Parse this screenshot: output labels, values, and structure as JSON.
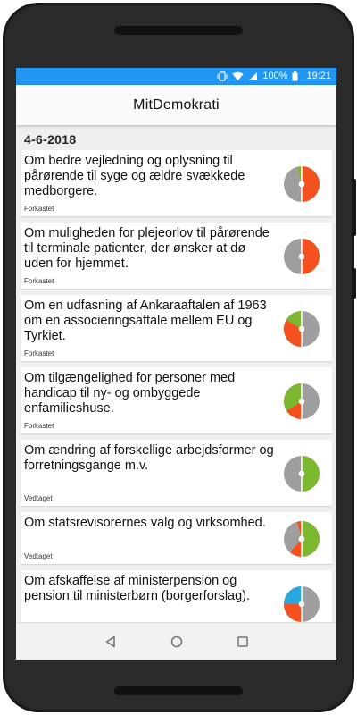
{
  "status_bar": {
    "battery": "100%",
    "time": "19:21"
  },
  "app": {
    "title": "MitDemokrati"
  },
  "section": {
    "date": "4-6-2018"
  },
  "proposals": [
    {
      "title": "Om bedre vejledning og oplysning til pårørende til syge og ældre svækkede medborgere.",
      "status": "Forkastet",
      "vote_icon": "vote-pie-chart",
      "colors": {
        "for": "#7cb82f",
        "against": "#f4511e",
        "absent": "#9e9e9e"
      }
    },
    {
      "title": "Om muligheden for plejeorlov til pårørende til terminale patienter, der ønsker at dø uden for hjemmet.",
      "status": "Forkastet",
      "vote_icon": "vote-pie-chart",
      "colors": {
        "for": "#7cb82f",
        "against": "#f4511e",
        "absent": "#9e9e9e"
      }
    },
    {
      "title": "Om en udfasning af Ankaraaftalen af 1963 om en associeringsaftale mellem EU og Tyrkiet.",
      "status": "Forkastet",
      "vote_icon": "vote-pie-chart",
      "colors": {
        "for": "#7cb82f",
        "against": "#f4511e",
        "absent": "#9e9e9e"
      }
    },
    {
      "title": "Om tilgængelighed for personer med handicap til ny- og ombyggede enfamilieshuse.",
      "status": "Forkastet",
      "vote_icon": "vote-pie-chart",
      "colors": {
        "for": "#7cb82f",
        "against": "#f4511e",
        "absent": "#9e9e9e"
      }
    },
    {
      "title": "Om ændring af forskellige arbejdsformer og forretningsgange m.v.",
      "status": "Vedtaget",
      "vote_icon": "vote-pie-chart",
      "colors": {
        "for": "#7cb82f",
        "against": "#f4511e",
        "absent": "#9e9e9e"
      }
    },
    {
      "title": "Om statsrevisorernes valg og virksomhed.",
      "status": "Vedtaget",
      "vote_icon": "vote-pie-chart",
      "colors": {
        "for": "#7cb82f",
        "against": "#f4511e",
        "absent": "#9e9e9e"
      }
    },
    {
      "title": "Om afskaffelse af ministerpension og pension til ministerbørn (borgerforslag).",
      "status": "",
      "vote_icon": "vote-pie-chart",
      "colors": {
        "citizen": "#29a8e0",
        "against": "#f4511e",
        "absent": "#9e9e9e"
      }
    }
  ],
  "nav": {
    "back_icon": "back-triangle-icon",
    "home_icon": "home-circle-icon",
    "recents_icon": "recents-square-icon"
  },
  "theme": {
    "status_bar": "#2196f3",
    "background": "#efefef"
  }
}
